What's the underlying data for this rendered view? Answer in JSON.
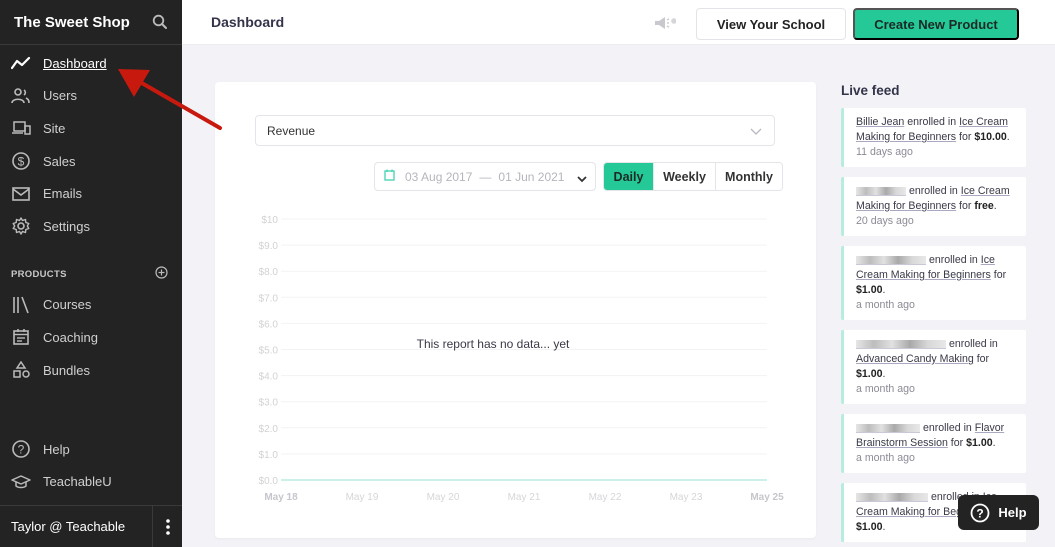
{
  "sidebar": {
    "title": "The Sweet Shop",
    "nav": [
      {
        "label": "Dashboard",
        "icon": "trend-line-icon",
        "active": true
      },
      {
        "label": "Users",
        "icon": "users-icon"
      },
      {
        "label": "Site",
        "icon": "devices-icon"
      },
      {
        "label": "Sales",
        "icon": "dollar-circle-icon"
      },
      {
        "label": "Emails",
        "icon": "envelope-icon"
      },
      {
        "label": "Settings",
        "icon": "gear-icon"
      }
    ],
    "products_section": "PRODUCTS",
    "products": [
      {
        "label": "Courses",
        "icon": "library-icon"
      },
      {
        "label": "Coaching",
        "icon": "calendar-note-icon"
      },
      {
        "label": "Bundles",
        "icon": "shapes-icon"
      }
    ],
    "bottom": [
      {
        "label": "Help",
        "icon": "question-circle-icon"
      },
      {
        "label": "TeachableU",
        "icon": "graduation-cap-icon"
      }
    ],
    "user": "Taylor @ Teachable"
  },
  "topbar": {
    "title": "Dashboard",
    "view_school": "View Your School",
    "create_product": "Create New Product"
  },
  "report": {
    "metric": "Revenue",
    "date_from": "03 Aug 2017",
    "date_sep": "—",
    "date_to": "01 Jun 2021",
    "periods": [
      "Daily",
      "Weekly",
      "Monthly"
    ],
    "active_period": "Daily",
    "empty_message": "This report has no data... yet"
  },
  "chart_data": {
    "type": "line",
    "title": "",
    "xlabel": "",
    "ylabel": "",
    "y_ticks": [
      "$0.0",
      "$1.0",
      "$2.0",
      "$3.0",
      "$4.0",
      "$5.0",
      "$6.0",
      "$7.0",
      "$8.0",
      "$9.0",
      "$10"
    ],
    "ylim": [
      0,
      10
    ],
    "x_ticks": [
      "May 18",
      "May 19",
      "May 20",
      "May 21",
      "May 22",
      "May 23",
      "May 25"
    ],
    "series": [
      {
        "name": "Revenue",
        "values": [
          0,
          0,
          0,
          0,
          0,
          0,
          0
        ]
      }
    ],
    "grid": true,
    "annotation": "This report has no data... yet",
    "line_color": "#b8ece0"
  },
  "live_feed": {
    "title": "Live feed",
    "items": [
      {
        "user": "Billie Jean",
        "user_hidden": false,
        "verb": " enrolled in ",
        "course": "Ice Cream Making for Beginners",
        "for": " for ",
        "amount": "$10.00",
        "time": "11 days ago"
      },
      {
        "user": "",
        "user_hidden": true,
        "verb": " enrolled in ",
        "course": "Ice Cream Making for Beginners",
        "for": " for ",
        "amount": "free",
        "time": "20 days ago"
      },
      {
        "user": "",
        "user_hidden": true,
        "verb": " enrolled in ",
        "course": "Ice Cream Making for Beginners",
        "for": " for ",
        "amount": "$1.00",
        "time": "a month ago"
      },
      {
        "user": "",
        "user_hidden": true,
        "verb": " enrolled in ",
        "course": "Advanced Candy Making",
        "for": " for ",
        "amount": "$1.00",
        "time": "a month ago"
      },
      {
        "user": "",
        "user_hidden": true,
        "verb": " enrolled in ",
        "course": "Flavor Brainstorm Session",
        "for": " for ",
        "amount": "$1.00",
        "time": "a month ago"
      },
      {
        "user": "",
        "user_hidden": true,
        "verb": " enrolled in ",
        "course": "Ice Cream Making for Beginners",
        "for": " for ",
        "amount": "$1.00",
        "time": ""
      }
    ]
  },
  "help_button": "Help",
  "colors": {
    "accent": "#25c997",
    "sidebar_bg": "#232323",
    "annotation_arrow": "#c8190f"
  }
}
